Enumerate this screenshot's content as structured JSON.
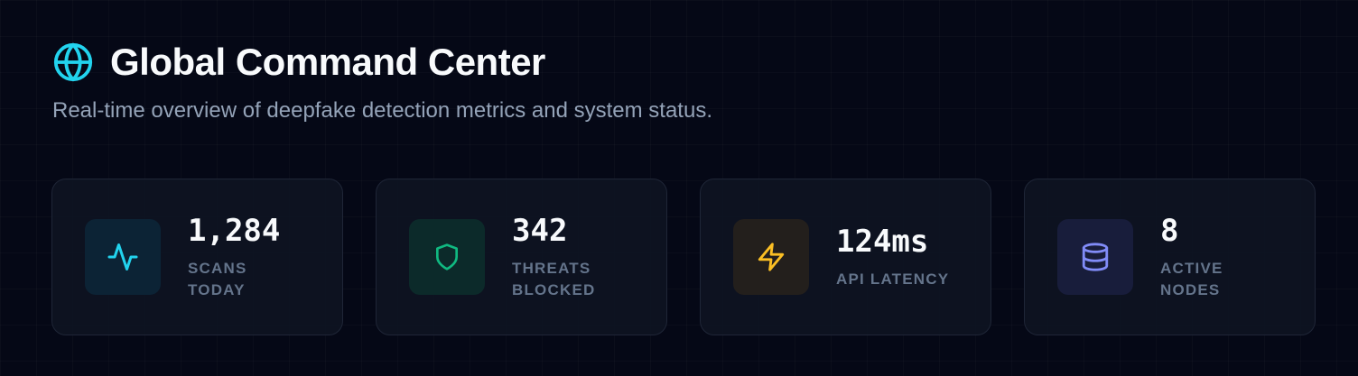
{
  "header": {
    "title": "Global Command Center",
    "subtitle": "Real-time overview of deepfake detection metrics and system status.",
    "icon": "globe-icon",
    "icon_color": "#22d3ee"
  },
  "stats": [
    {
      "value": "1,284",
      "label": "Scans Today",
      "icon": "activity-icon",
      "icon_color": "#22d3ee",
      "icon_bg": "#0c2335"
    },
    {
      "value": "342",
      "label": "Threats Blocked",
      "icon": "shield-icon",
      "icon_color": "#10b981",
      "icon_bg": "#0c2a2a"
    },
    {
      "value": "124ms",
      "label": "API Latency",
      "icon": "lightning-bolt-icon",
      "icon_color": "#fbbf24",
      "icon_bg": "#231f1c"
    },
    {
      "value": "8",
      "label": "Active Nodes",
      "icon": "database-icon",
      "icon_color": "#818cf8",
      "icon_bg": "#181d3b"
    }
  ]
}
